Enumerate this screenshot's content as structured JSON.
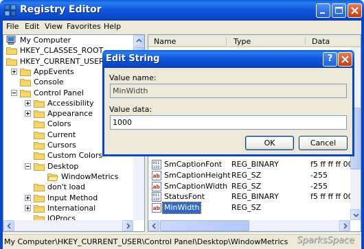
{
  "window": {
    "title": "Registry Editor"
  },
  "menu": [
    "File",
    "Edit",
    "View",
    "Favorites",
    "Help"
  ],
  "tree": {
    "items": [
      {
        "label": "My Computer"
      },
      {
        "label": "HKEY_CLASSES_ROOT",
        "expander": "plus"
      },
      {
        "label": "HKEY_CURRENT_USER",
        "expander": "minus"
      },
      {
        "label": "AppEvents",
        "expander": "plus"
      },
      {
        "label": "Console"
      },
      {
        "label": "Control Panel",
        "expander": "minus"
      },
      {
        "label": "Accessibility",
        "expander": "plus"
      },
      {
        "label": "Appearance",
        "expander": "plus"
      },
      {
        "label": "Colors"
      },
      {
        "label": "Current"
      },
      {
        "label": "Cursors"
      },
      {
        "label": "Custom Colors"
      },
      {
        "label": "Desktop",
        "expander": "minus"
      },
      {
        "label": "WindowMetrics"
      },
      {
        "label": "don't load"
      },
      {
        "label": "Input Method",
        "expander": "plus"
      },
      {
        "label": "International",
        "expander": "plus"
      },
      {
        "label": "IOProcs"
      }
    ]
  },
  "list": {
    "columns": [
      "Name",
      "Type",
      "Data"
    ],
    "rows": [
      {
        "name": "SmCaptionFont",
        "type": "REG_BINARY",
        "data": "f5 ff ff ff 00",
        "icon": "binary"
      },
      {
        "name": "SmCaptionHeight",
        "type": "REG_SZ",
        "data": "-255",
        "icon": "string"
      },
      {
        "name": "SmCaptionWidth",
        "type": "REG_SZ",
        "data": "-255",
        "icon": "string"
      },
      {
        "name": "StatusFont",
        "type": "REG_BINARY",
        "data": "f5 ff ff ff 00",
        "icon": "binary"
      },
      {
        "name": "MinWidth",
        "type": "REG_SZ",
        "data": "",
        "icon": "string",
        "selected": true
      }
    ]
  },
  "status": {
    "path": "My Computer\\HKEY_CURRENT_USER\\Control Panel\\Desktop\\WindowMetrics"
  },
  "watermark": "SparksSpace",
  "dialog": {
    "title": "Edit String",
    "value_name_label": "Value name:",
    "value_name": "MinWidth",
    "value_data_label": "Value data:",
    "value_data": "1000",
    "ok_label": "OK",
    "cancel_label": "Cancel"
  },
  "colors": {
    "title_bar": "#0a47c8",
    "selection": "#316ac5",
    "close_button": "#c53a12"
  }
}
